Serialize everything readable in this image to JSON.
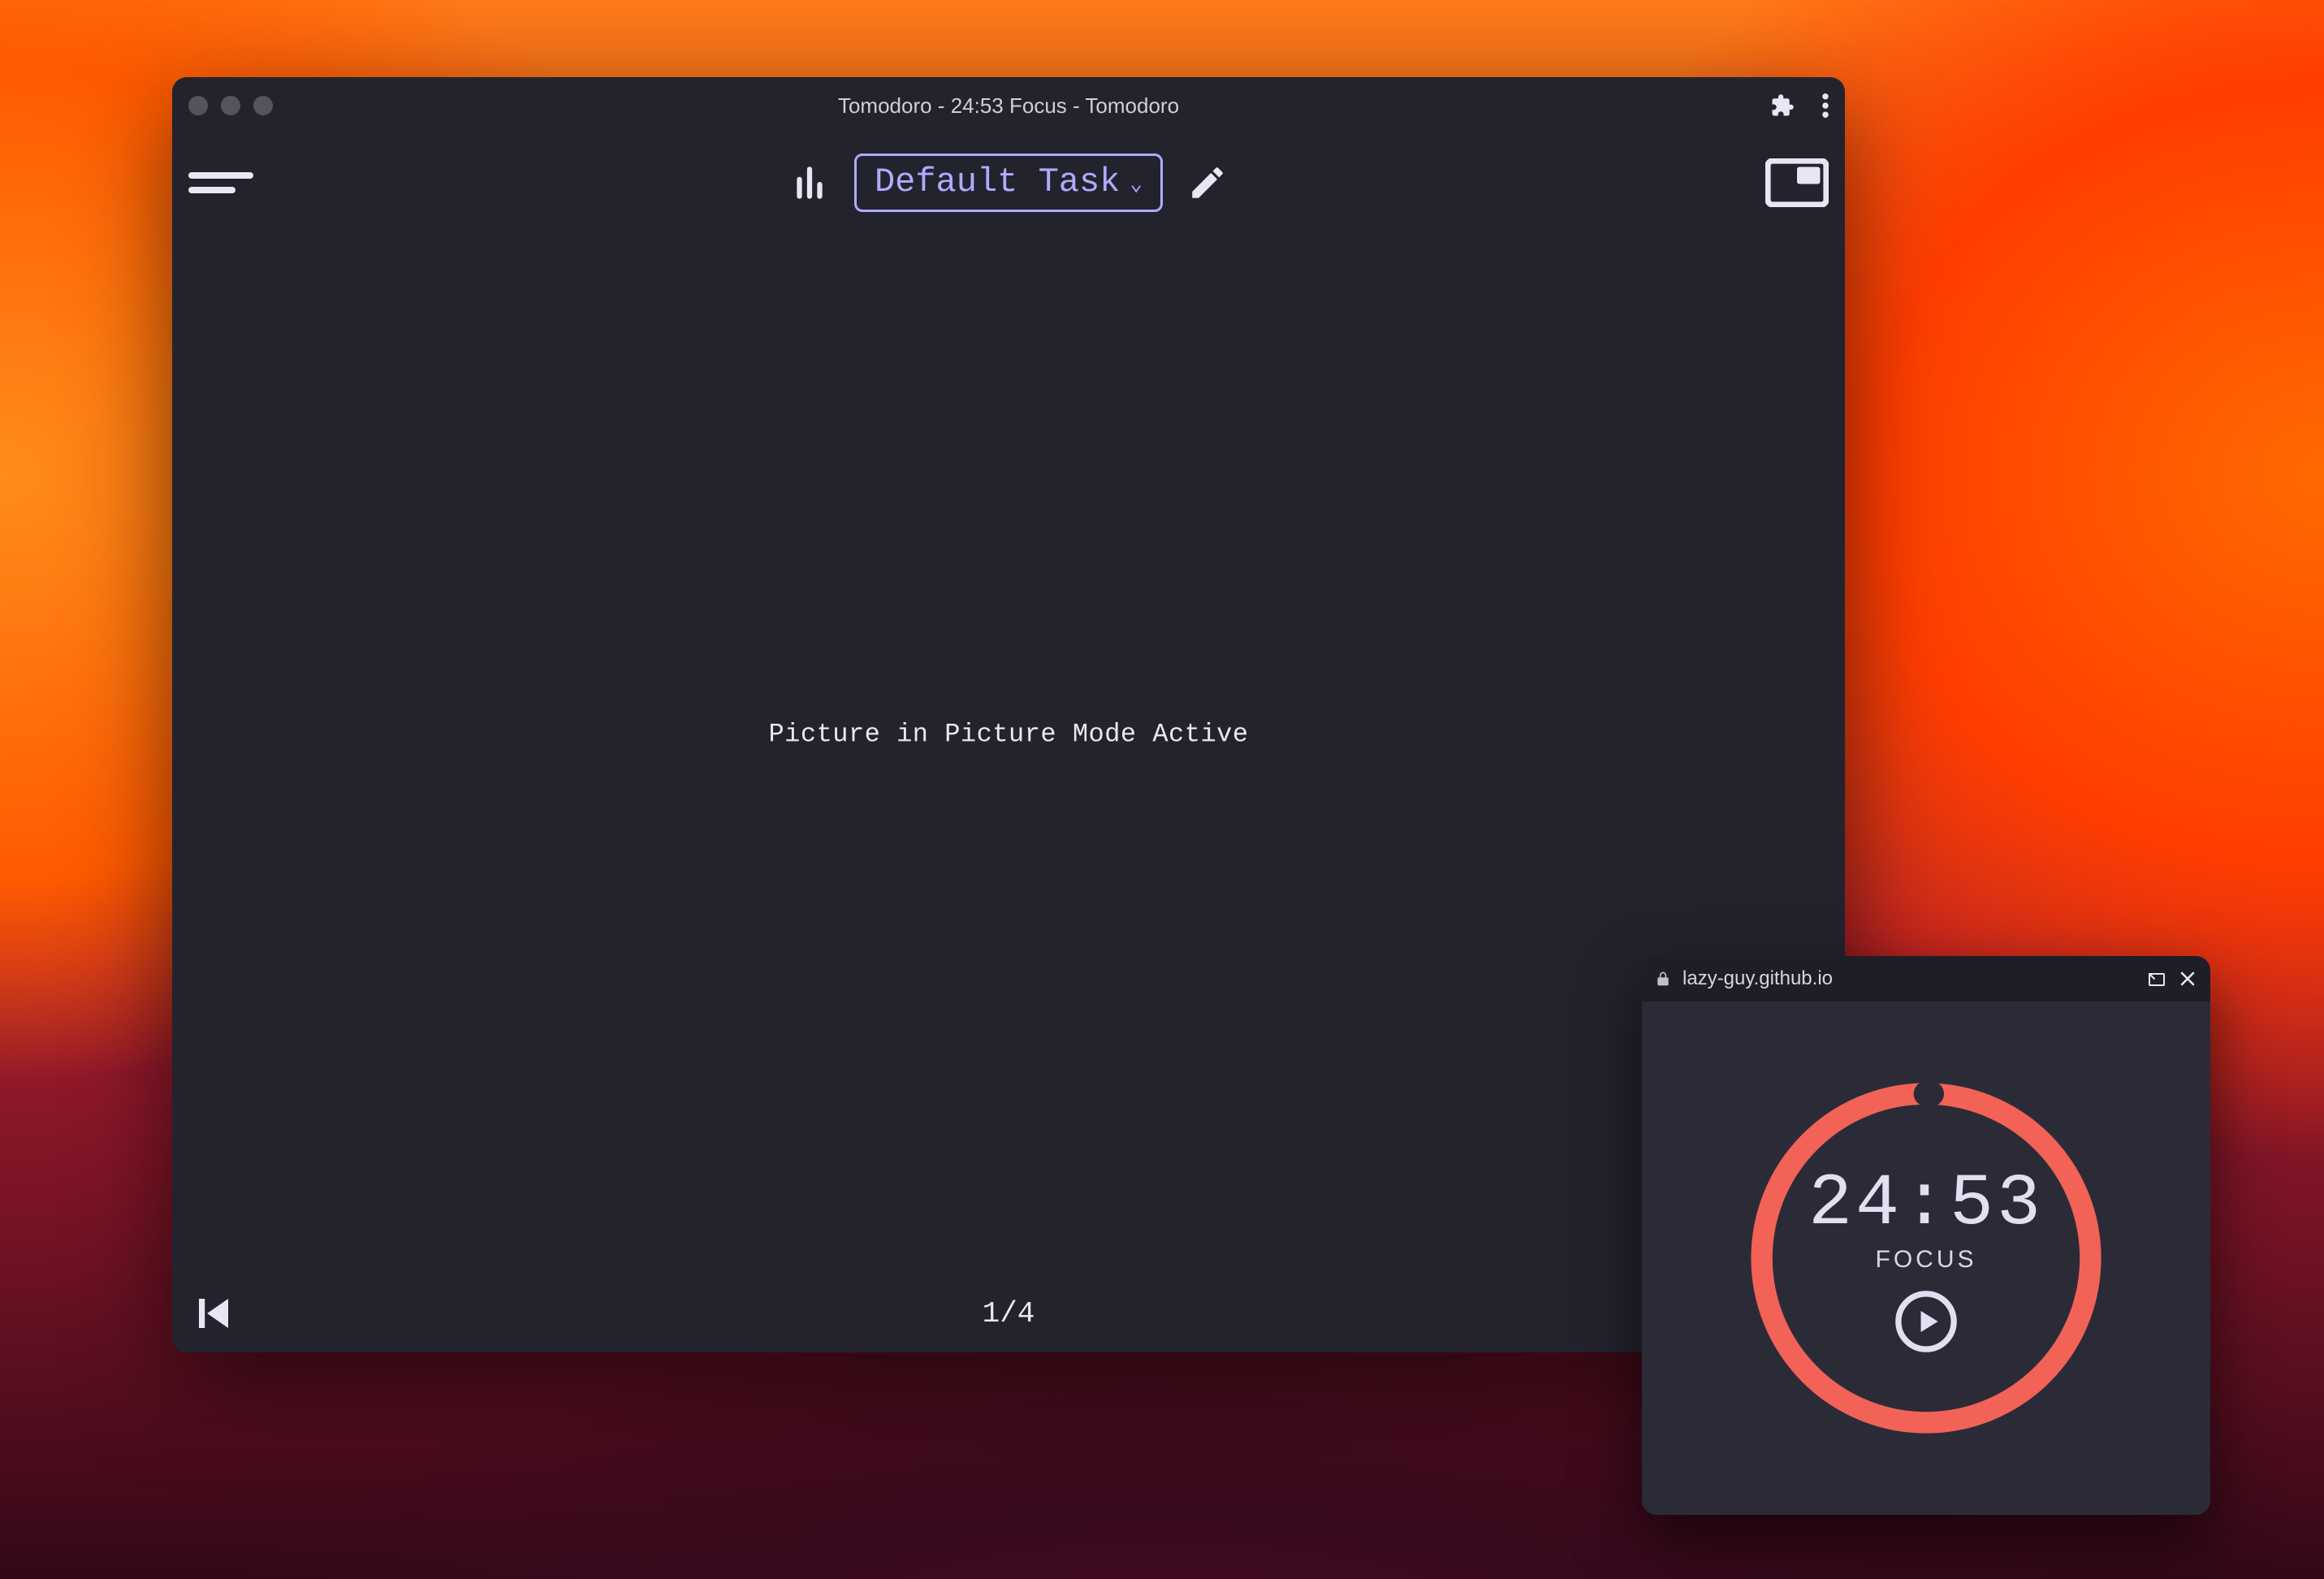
{
  "window": {
    "title": "Tomodoro - 24:53 Focus - Tomodoro"
  },
  "toolbar": {
    "task_label": "Default Task"
  },
  "content": {
    "pip_message": "Picture in Picture Mode Active"
  },
  "pager": {
    "text": "1/4",
    "current": 1,
    "total": 4
  },
  "pip": {
    "origin": "lazy-guy.github.io",
    "time": "24:53",
    "mode": "FOCUS",
    "progress_fraction": 0.005,
    "ring_color": "#f26257",
    "text_color": "#e2dff2"
  }
}
